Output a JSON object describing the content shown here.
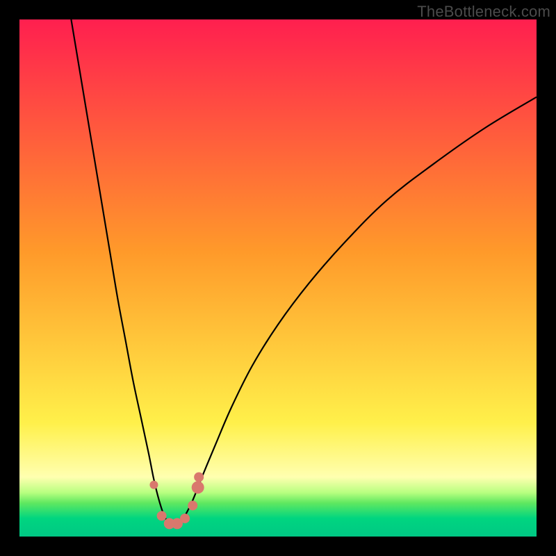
{
  "watermark": "TheBottleneck.com",
  "chart_data": {
    "type": "line",
    "title": "",
    "xlabel": "",
    "ylabel": "",
    "xlim": [
      0,
      100
    ],
    "ylim": [
      0,
      100
    ],
    "grid": false,
    "legend": false,
    "background_gradient": {
      "stops": [
        {
          "pos": 0.0,
          "color": "#ff1f4f"
        },
        {
          "pos": 0.45,
          "color": "#ff9a2a"
        },
        {
          "pos": 0.78,
          "color": "#fff04a"
        },
        {
          "pos": 0.885,
          "color": "#ffffb0"
        },
        {
          "pos": 0.915,
          "color": "#b8ff80"
        },
        {
          "pos": 0.935,
          "color": "#60e860"
        },
        {
          "pos": 0.965,
          "color": "#00d580"
        },
        {
          "pos": 1.0,
          "color": "#00c884"
        }
      ]
    },
    "curve": {
      "description": "Bottleneck curve: single V-shaped dip reaching the green band, asymmetric with right arm rising more gradually",
      "x": [
        10.0,
        11.5,
        13.0,
        14.5,
        16.0,
        17.5,
        19.0,
        20.5,
        22.0,
        23.5,
        25.0,
        26.0,
        27.0,
        28.0,
        29.0,
        30.0,
        31.0,
        32.0,
        33.5,
        35.5,
        38.0,
        41.0,
        45.0,
        50.0,
        56.0,
        63.0,
        71.0,
        80.0,
        90.0,
        100.0
      ],
      "y": [
        100.0,
        91.0,
        82.0,
        73.0,
        64.0,
        55.0,
        46.0,
        38.0,
        30.0,
        23.0,
        16.0,
        11.0,
        7.0,
        4.0,
        2.5,
        2.0,
        2.5,
        4.0,
        7.0,
        12.0,
        18.0,
        25.0,
        33.0,
        41.0,
        49.0,
        57.0,
        65.0,
        72.0,
        79.0,
        85.0
      ]
    },
    "markers": {
      "description": "soft red dots clustered near the bottom of the V",
      "color": "#d9786d",
      "points": [
        {
          "x": 26.0,
          "y": 10.0,
          "r": 6
        },
        {
          "x": 27.5,
          "y": 4.0,
          "r": 7
        },
        {
          "x": 29.0,
          "y": 2.5,
          "r": 8
        },
        {
          "x": 30.5,
          "y": 2.5,
          "r": 8
        },
        {
          "x": 32.0,
          "y": 3.5,
          "r": 7
        },
        {
          "x": 33.5,
          "y": 6.0,
          "r": 7
        },
        {
          "x": 34.5,
          "y": 9.5,
          "r": 9
        },
        {
          "x": 34.7,
          "y": 11.5,
          "r": 7
        }
      ]
    }
  }
}
